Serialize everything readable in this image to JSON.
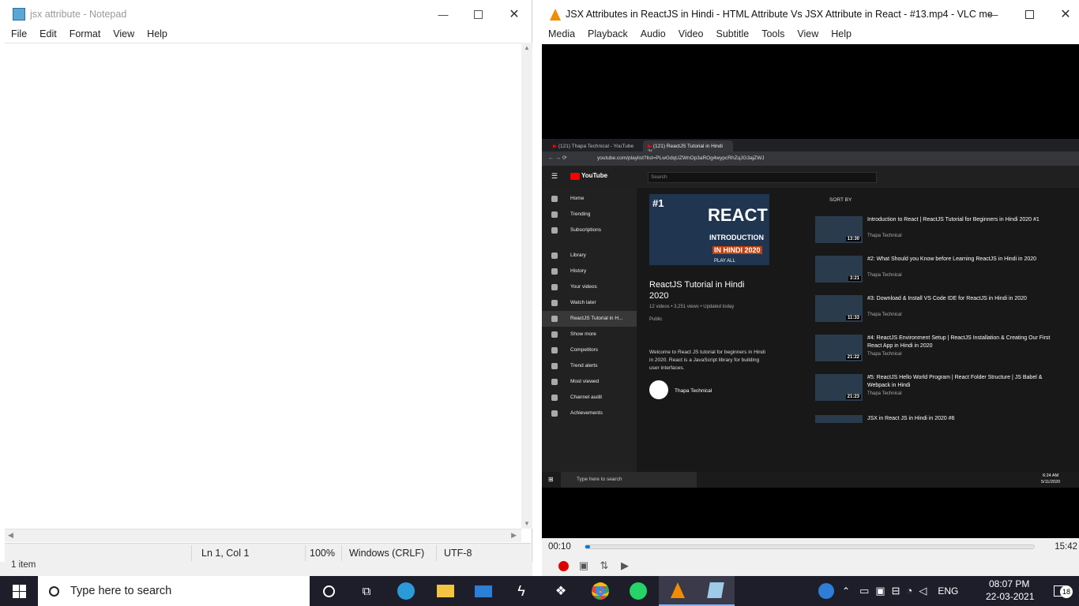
{
  "notepad": {
    "title": "jsx attribute - Notepad",
    "menu": [
      "File",
      "Edit",
      "Format",
      "View",
      "Help"
    ],
    "status": {
      "position": "Ln 1, Col 1",
      "zoom": "100%",
      "line_ending": "Windows (CRLF)",
      "encoding": "UTF-8"
    }
  },
  "explorer_status": "1 item",
  "vlc": {
    "title": "JSX Attributes in ReactJS in Hindi - HTML Attribute Vs JSX Attribute in React  - #13.mp4 - VLC me...",
    "menu": [
      "Media",
      "Playback",
      "Audio",
      "Video",
      "Subtitle",
      "Tools",
      "View",
      "Help"
    ],
    "time_elapsed": "00:10",
    "time_total": "15:42",
    "progress": 0.011
  },
  "browser": {
    "tabs": [
      "(121) Thapa Technical - YouTube",
      "(121) ReactJS Tutorial in Hindi 2("
    ],
    "url": "youtube.com/playlist?list=PLwGdqUZWnOp3aROg4wypcRhZqJG3ajZWJ",
    "search_placeholder": "Search",
    "logo": "YouTube",
    "sidebar": [
      "Home",
      "Trending",
      "Subscriptions",
      "Library",
      "History",
      "Your videos",
      "Watch later",
      "ReactJS Tutorial in H...",
      "Show more",
      "Competitors",
      "Trend alerts",
      "Most viewed",
      "Channel audit",
      "Achievements"
    ],
    "playlist": {
      "thumb_badge": "#1",
      "thumb_big": "REACT",
      "thumb_sub": "INTRODUCTION",
      "thumb_sub2": "IN HINDI 2020",
      "play_all": "PLAY ALL",
      "title": "ReactJS Tutorial in Hindi 2020",
      "meta": "12 videos • 3,251 views • Updated today",
      "privacy": "Public",
      "description": "Welcome to React JS tutorial for beginners in Hindi in 2020. React is a JavaScript library for building user interfaces.",
      "channel": "Thapa Technical"
    },
    "sort_by": "SORT BY",
    "videos": [
      {
        "title": "Introduction to React | ReactJS Tutorial for Beginners in Hindi 2020 #1",
        "channel": "Thapa Technical",
        "duration": "13:30"
      },
      {
        "title": "#2: What Should you Know before Learning ReactJS in Hindi in 2020",
        "channel": "Thapa Technical",
        "duration": "3:21"
      },
      {
        "title": "#3: Download & Install VS Code IDE for ReactJS in Hindi in 2020",
        "channel": "Thapa Technical",
        "duration": "11:33"
      },
      {
        "title": "#4: ReactJS Environment Setup | ReactJS Installation & Creating Our First React App in Hindi in 2020",
        "channel": "Thapa Technical",
        "duration": "21:22"
      },
      {
        "title": "#5: ReactJS Hello World Program | React Folder Structure | JS Babel & Webpack in Hindi",
        "channel": "Thapa Technical",
        "duration": "21:23"
      },
      {
        "title": "JSX in React JS in Hindi in 2020 #6",
        "channel": "",
        "duration": ""
      }
    ],
    "inner_taskbar": {
      "search": "Type here to search",
      "time": "6:24 AM",
      "date": "5/11/2020"
    }
  },
  "taskbar": {
    "search_placeholder": "Type here to search",
    "lang": "ENG",
    "time": "08:07 PM",
    "date": "22-03-2021",
    "notifications": "18"
  }
}
